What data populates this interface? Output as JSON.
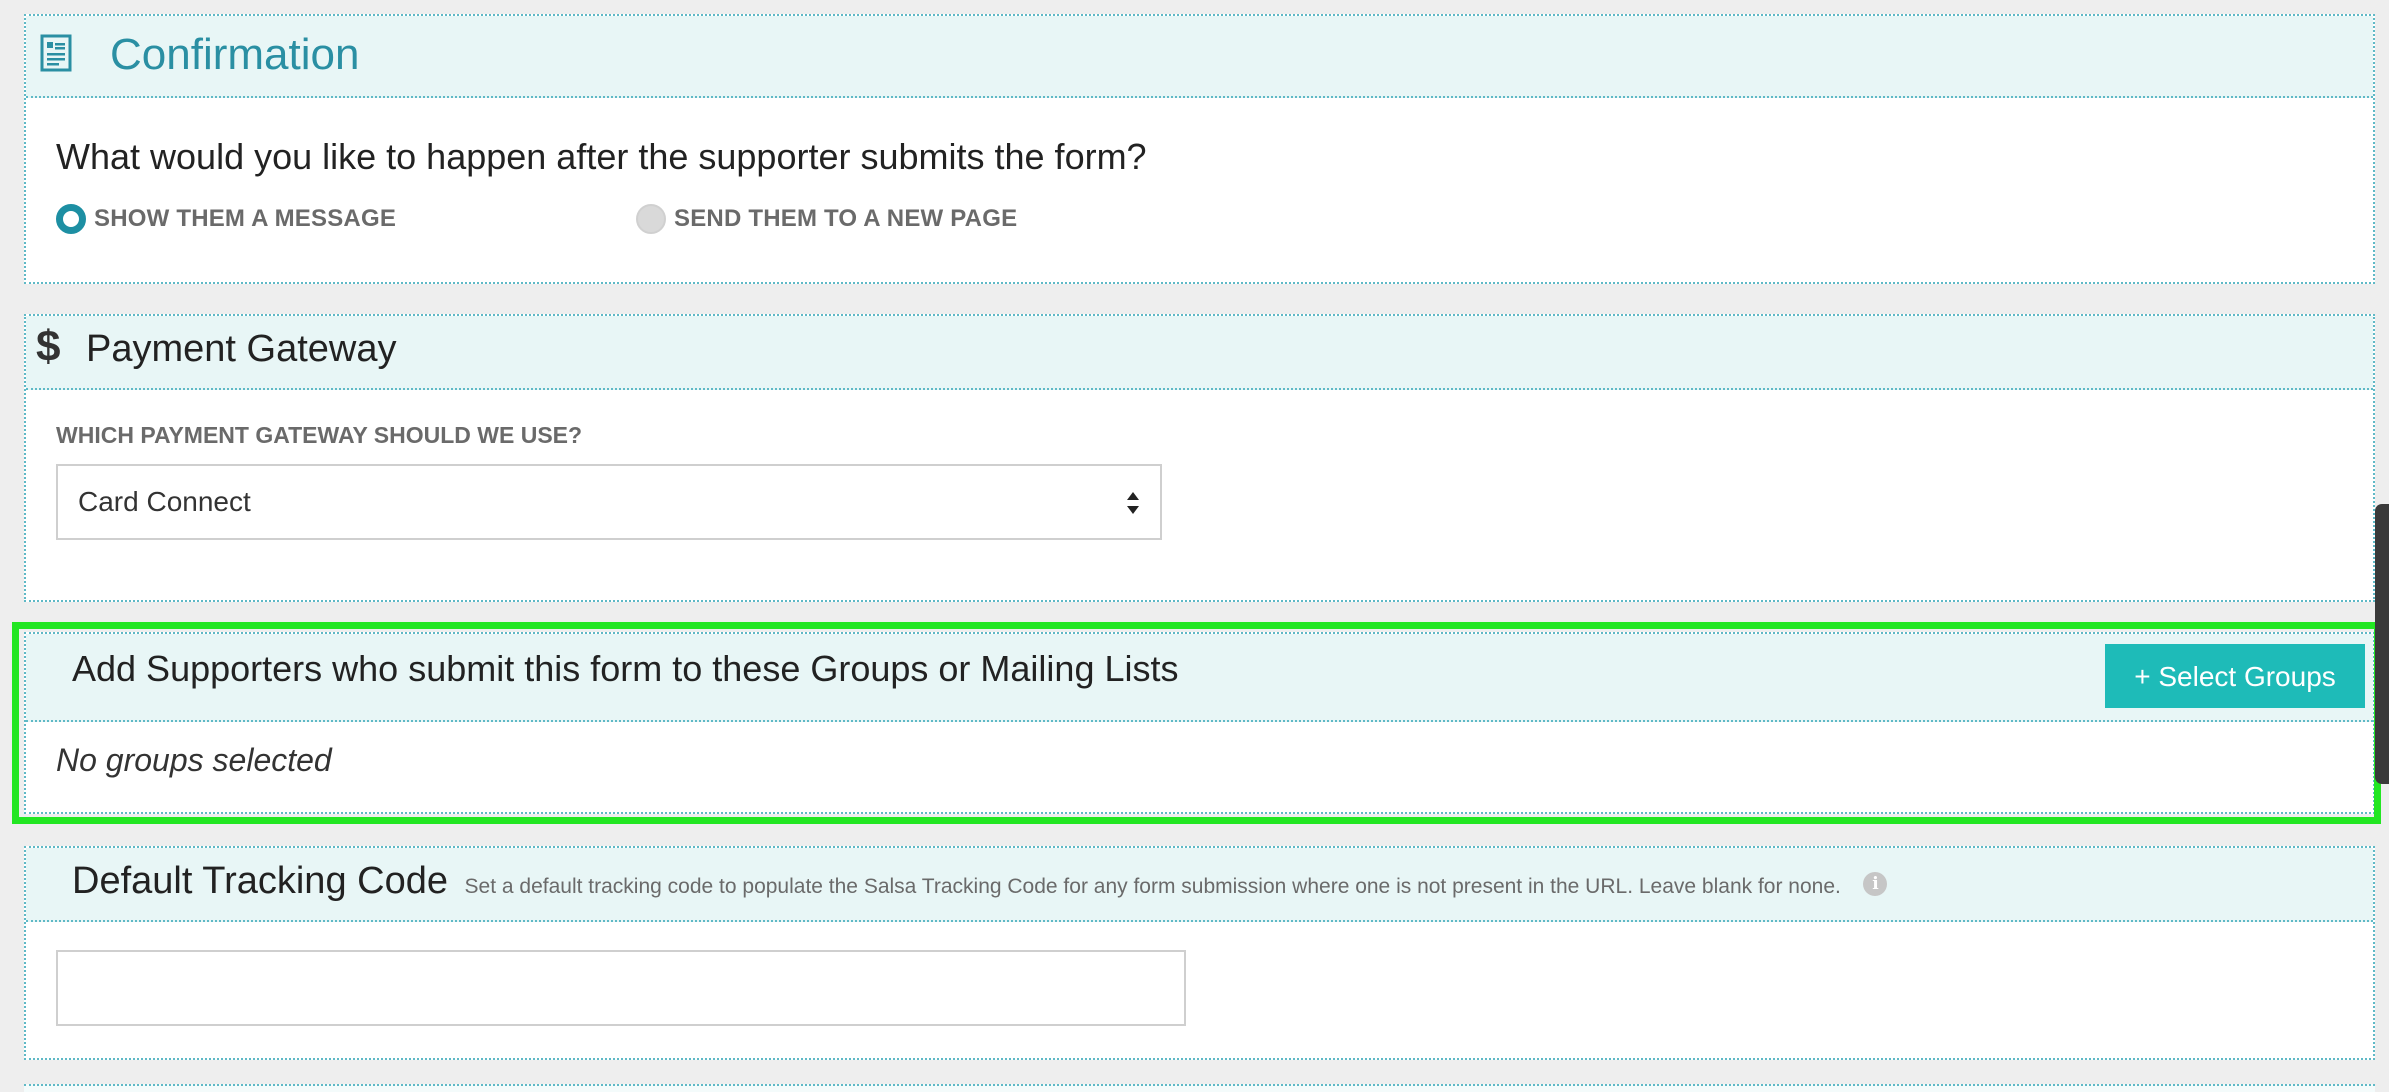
{
  "confirmation": {
    "title": "Confirmation",
    "icon": "form-icon",
    "question": "What would you like to happen after the supporter submits the form?",
    "options": [
      {
        "label": "SHOW THEM A MESSAGE",
        "selected": true
      },
      {
        "label": "SEND THEM TO A NEW PAGE",
        "selected": false
      }
    ]
  },
  "payment": {
    "title": "Payment Gateway",
    "icon": "dollar-icon",
    "icon_glyph": "$",
    "field_label": "WHICH PAYMENT GATEWAY SHOULD WE USE?",
    "selected_gateway": "Card Connect"
  },
  "groups": {
    "title": "Add Supporters who submit this form to these Groups or Mailing Lists",
    "button_label": "+ Select Groups",
    "empty_text": "No groups selected"
  },
  "tracking": {
    "title": "Default Tracking Code",
    "description": "Set a default tracking code to populate the Salsa Tracking Code for any form submission where one is not present in the URL. Leave blank for none.",
    "info_glyph": "i",
    "value": ""
  },
  "colors": {
    "accent": "#1d8fa3",
    "button": "#1ebbb8",
    "highlight": "#22e622",
    "header_bg": "#e8f6f6"
  }
}
